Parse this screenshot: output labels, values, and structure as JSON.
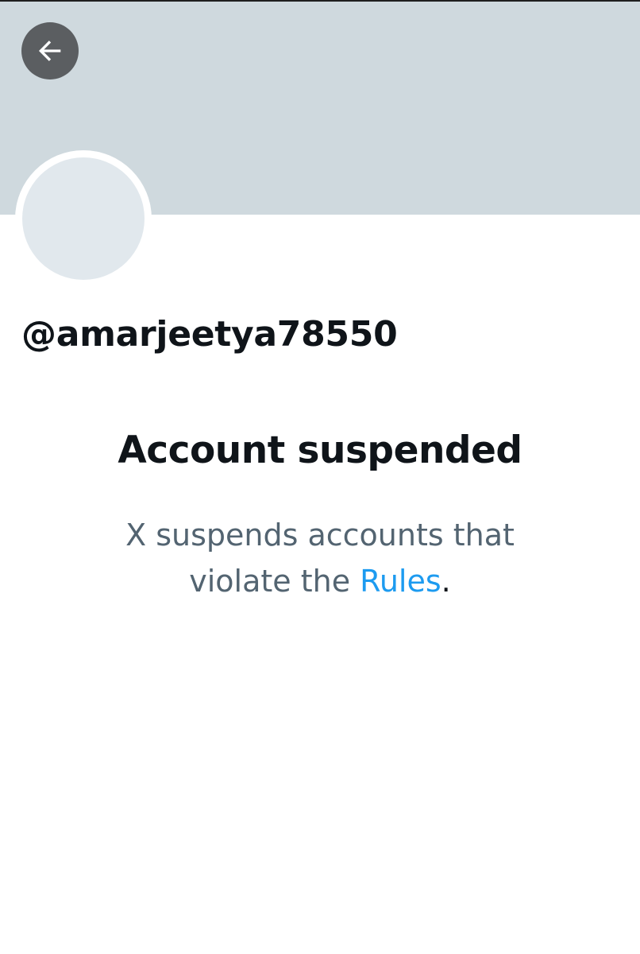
{
  "header": {
    "back_icon": "arrow-left-icon",
    "banner_color": "#cfd9de"
  },
  "profile": {
    "handle": "@amarjeetya78550",
    "avatar_color": "#e1e8ed"
  },
  "suspension": {
    "title": "Account suspended",
    "line1": "X suspends accounts that",
    "line2_prefix": "violate the ",
    "rules_link": "Rules",
    "period": ".",
    "text_color": "#536471",
    "link_color": "#1d9bf0"
  }
}
